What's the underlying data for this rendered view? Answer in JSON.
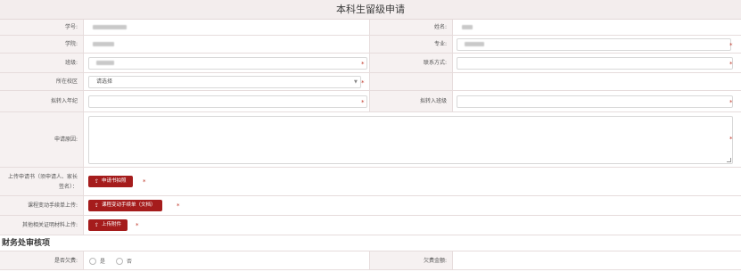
{
  "page_title": "本科生留级申请",
  "form": {
    "student_id_label": "学号:",
    "name_label": "姓名:",
    "college_label": "学院:",
    "major_label": "专业:",
    "class_label": "班级:",
    "contact_label": "联系方式:",
    "campus_label": "所在校区",
    "campus_placeholder": "请选择",
    "transfer_grade_label": "拟转入年纪",
    "transfer_class_label": "拟转入班级",
    "reason_label": "申请原因:",
    "upload_application_label": "上传申请书（须申请人、家长签名）：",
    "upload_application_button": "申请书拍照",
    "upload_course_change_label": "课程变动手续单上传:",
    "upload_course_change_button": "课程变动手续单（文档）",
    "upload_other_label": "其他相关证明材料上传:",
    "upload_other_button": "上传附件",
    "required_mark": "*"
  },
  "finance": {
    "section_title": "财务处审核项",
    "arrears_label": "是否欠费:",
    "option_yes": "是",
    "option_no": "否",
    "arrears_amount_label": "欠费金额:"
  },
  "icons": {
    "upload": "upload-icon",
    "dropdown": "chevron-down-icon"
  },
  "colors": {
    "accent": "#a51c1c",
    "required": "#c0392b",
    "label_bg": "#f6f1f1",
    "title_bg": "#f3eded"
  }
}
